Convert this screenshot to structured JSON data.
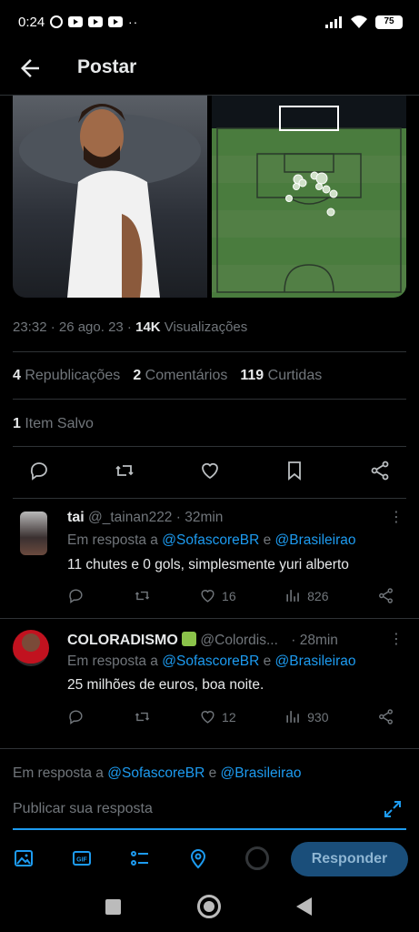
{
  "status_bar": {
    "time": "0:24",
    "battery": "75"
  },
  "header": {
    "title": "Postar"
  },
  "post": {
    "timestamp": "23:32 · 26 ago. 23 · ",
    "views_count": "14K",
    "views_label": " Visualizações",
    "reposts_count": "4",
    "reposts_label": " Republicações",
    "comments_count": "2",
    "comments_label": " Comentários",
    "likes_count": "119",
    "likes_label": " Curtidas",
    "saved_count": "1",
    "saved_label": " Item Salvo"
  },
  "replies": [
    {
      "name": "tai",
      "handle": "@_tainan222 · 32min",
      "in_reply_prefix": "Em resposta a ",
      "mention1": "@SofascoreBR",
      "joiner": " e ",
      "mention2": "@Brasileirao",
      "text": "11 chutes e 0 gols, simplesmente yuri alberto",
      "likes": "16",
      "views": "826"
    },
    {
      "name": "COLORADISMO",
      "handle": "@Colordis...",
      "time": "· 28min",
      "in_reply_prefix": "Em resposta a ",
      "mention1": "@SofascoreBR",
      "joiner": " e ",
      "mention2": "@Brasileirao",
      "text": "25 milhões de euros, boa noite.",
      "likes": "12",
      "views": "930"
    }
  ],
  "composer": {
    "in_reply_prefix": "Em resposta a ",
    "mention1": "@SofascoreBR",
    "joiner": " e ",
    "mention2": "@Brasileirao",
    "placeholder": "Publicar sua resposta",
    "respond_label": "Responder"
  },
  "icons": {
    "back": "arrow-left-icon",
    "reply": "comment-icon",
    "repost": "repost-icon",
    "like": "heart-icon",
    "bookmark": "bookmark-icon",
    "share": "share-icon",
    "views": "bar-chart-icon",
    "image": "image-icon",
    "gif": "gif-icon",
    "poll": "poll-icon",
    "location": "location-icon"
  },
  "colors": {
    "accent": "#1d9bf0",
    "text": "#e7e9ea",
    "muted": "#71767b",
    "bg": "#000000"
  }
}
